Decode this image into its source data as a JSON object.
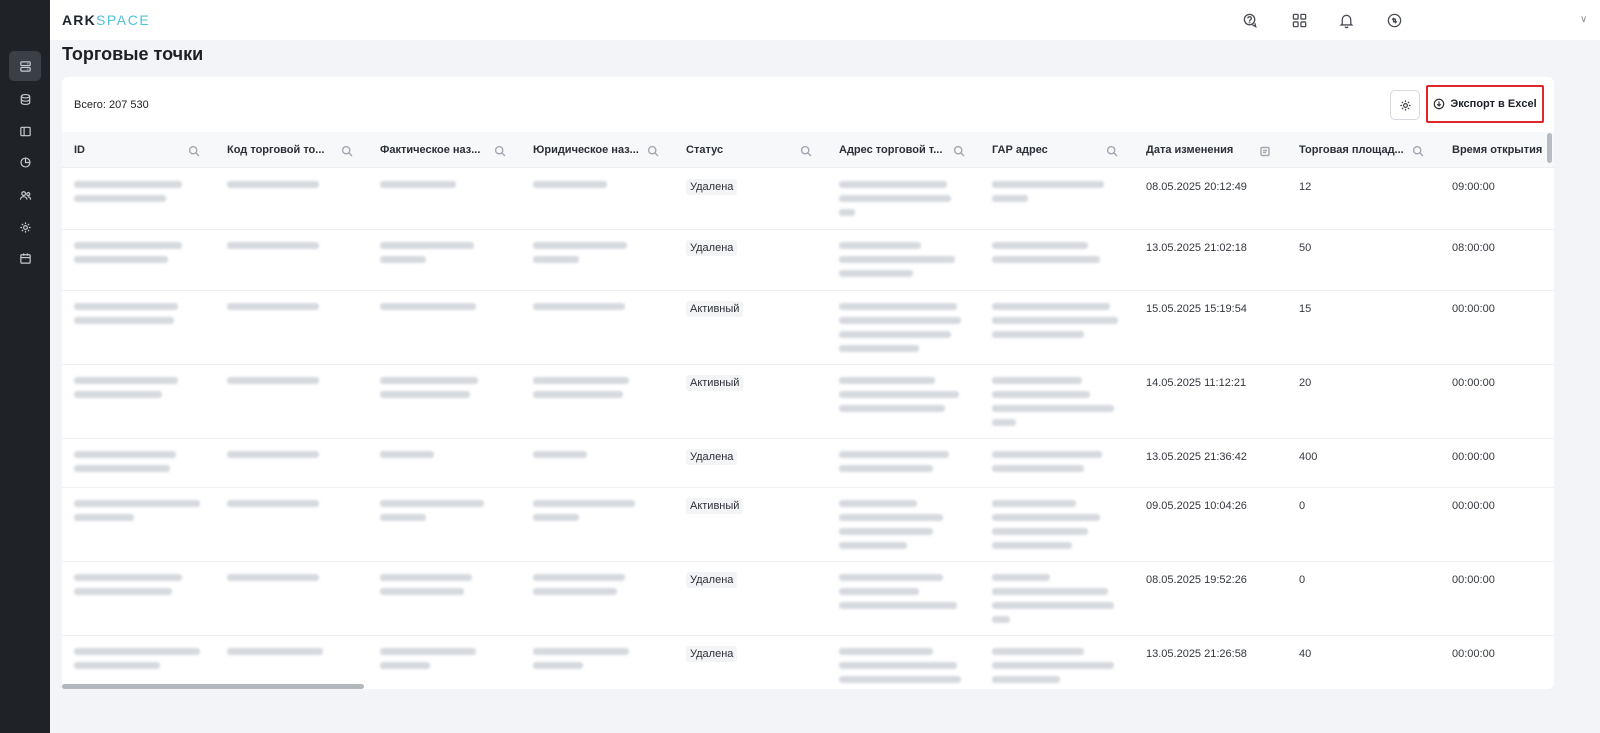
{
  "app": {
    "logo_ark": "ARK",
    "logo_space": "SPACE"
  },
  "sidebar": {
    "items": [
      {
        "icon": "servers-icon"
      },
      {
        "icon": "database-icon"
      },
      {
        "icon": "sidebar-panel-icon"
      },
      {
        "icon": "pie-chart-icon"
      },
      {
        "icon": "users-icon"
      },
      {
        "icon": "gear-icon"
      },
      {
        "icon": "calendar-icon"
      }
    ]
  },
  "header": {
    "icons": [
      "support-chat-icon",
      "apps-grid-icon",
      "bell-icon",
      "sync-icon"
    ]
  },
  "page": {
    "title": "Торговые точки"
  },
  "summary": {
    "total": "Всего: 207 530"
  },
  "toolbar": {
    "export_label": "Экспорт в Excel"
  },
  "table": {
    "columns": [
      {
        "label": "ID",
        "icon": "search-icon"
      },
      {
        "label": "Код торговой то...",
        "icon": "search-icon"
      },
      {
        "label": "Фактическое наз...",
        "icon": "search-icon"
      },
      {
        "label": "Юридическое наз...",
        "icon": "search-icon"
      },
      {
        "label": "Статус",
        "icon": "search-icon"
      },
      {
        "label": "Адрес торговой т...",
        "icon": "search-icon"
      },
      {
        "label": "ГАР адрес",
        "icon": "search-icon"
      },
      {
        "label": "Дата изменения",
        "icon": "calendar-icon"
      },
      {
        "label": "Торговая площад...",
        "icon": "search-icon"
      },
      {
        "label": "Время открытия",
        "icon": ""
      }
    ],
    "rows": [
      {
        "status": "Удалена",
        "changed": "08.05.2025 20:12:49",
        "area": "12",
        "open": "09:00:00"
      },
      {
        "status": "Удалена",
        "changed": "13.05.2025 21:02:18",
        "area": "50",
        "open": "08:00:00"
      },
      {
        "status": "Активный",
        "changed": "15.05.2025 15:19:54",
        "area": "15",
        "open": "00:00:00"
      },
      {
        "status": "Активный",
        "changed": "14.05.2025 11:12:21",
        "area": "20",
        "open": "00:00:00"
      },
      {
        "status": "Удалена",
        "changed": "13.05.2025 21:36:42",
        "area": "400",
        "open": "00:00:00"
      },
      {
        "status": "Активный",
        "changed": "09.05.2025 10:04:26",
        "area": "0",
        "open": "00:00:00"
      },
      {
        "status": "Удалена",
        "changed": "08.05.2025 19:52:26",
        "area": "0",
        "open": "00:00:00"
      },
      {
        "status": "Удалена",
        "changed": "13.05.2025 21:26:58",
        "area": "40",
        "open": "00:00:00"
      }
    ]
  },
  "colors": {
    "accent_red": "#e0262b",
    "sidebar_bg": "#1f2227",
    "logo_cyan": "#4ec3d6"
  }
}
